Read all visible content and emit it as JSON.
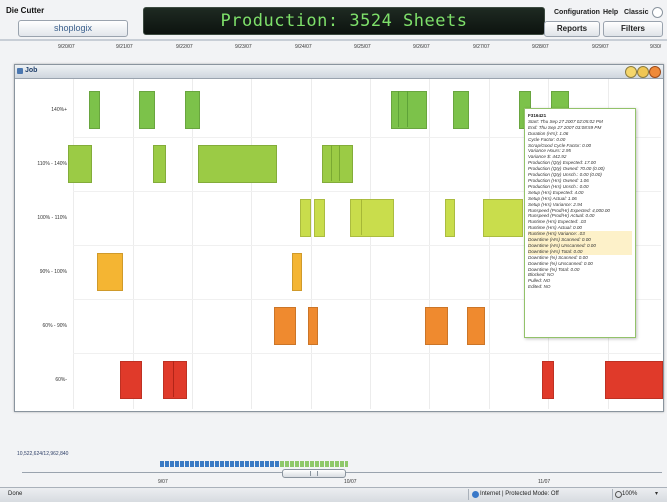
{
  "header": {
    "app_title": "Die Cutter",
    "brand": "shoplogix",
    "banner": "Production: 3524 Sheets",
    "links": [
      "Configuration",
      "Help",
      "Classic"
    ],
    "buttons": [
      "Reports",
      "Filters"
    ]
  },
  "date_ticks": [
    "9/20/07",
    "9/21/07",
    "9/22/07",
    "9/23/07",
    "9/24/07",
    "9/25/07",
    "9/26/07",
    "9/27/07",
    "9/28/07",
    "9/29/07",
    "9/30/"
  ],
  "panel": {
    "title": "Job",
    "row_labels": [
      "140%+",
      "110% - 140%",
      "100% - 110%",
      "90% - 100%",
      "60% - 90%",
      "60%-"
    ]
  },
  "colors": {
    "green": "#7cc24a",
    "light_green": "#b8d84a",
    "lime": "#c9dd4c",
    "yellow": "#f4b533",
    "orange": "#ef8a2f",
    "red": "#e03a2a",
    "banner_text": "#7ee06a"
  },
  "tooltip": {
    "title": "F316421",
    "lines": [
      "Start: Thu Sep 27 2007 02:05:02 PM",
      "End: Thu Sep 27 2007 03:08:59 PM",
      "Duration (Hrs): 1.06",
      "Cycle Factor: 0.00",
      "Scrap/Good Cycle Factor: 0.00",
      "Variance Hours: 2.95",
      "Variance $: 442.92",
      "Production (Qty) Expected: 17.00",
      "Production (Qty) Owned: 70.00 (0.00)",
      "Production (Qty) Unsch.: 0.00 (0.00)",
      "Production (Hrs) Owned: 1.06",
      "Production (Hrs) Unsch.: 0.00",
      "Setup (Hrs) Expected: 4.00",
      "Setup (Hrs) Actual: 1.06",
      "Setup (Hrs) Variance: 2.94",
      "Runspeed (Prod/Hr) Expected: 4,000.00",
      "Runspeed (Prod/Hr) Actual: 0.00",
      "Runtime (Hrs) Expected: .03",
      "Runtime (Hrs) Actual: 0.00",
      "Runtime (Hrs) Variance: .03",
      "Downtime (Hrs) Scanned: 0.00",
      "Downtime (Hrs) Unscanned: 0.00",
      "Downtime (Hrs) Total: 0.00",
      "Downtime (%) Scanned: 0.00",
      "Downtime (%) Unscanned: 0.00",
      "Downtime (%) Total: 0.00",
      "Blocked: NO",
      "Pulled: NO",
      "Edited: NO"
    ]
  },
  "footer": {
    "counter": "10,522,624/12,962,840",
    "bottom_ticks": [
      "9/07",
      "10/07",
      "11/07"
    ],
    "status": "Done",
    "zone": "Internet | Protected Mode: Off",
    "zoom": "100%"
  }
}
